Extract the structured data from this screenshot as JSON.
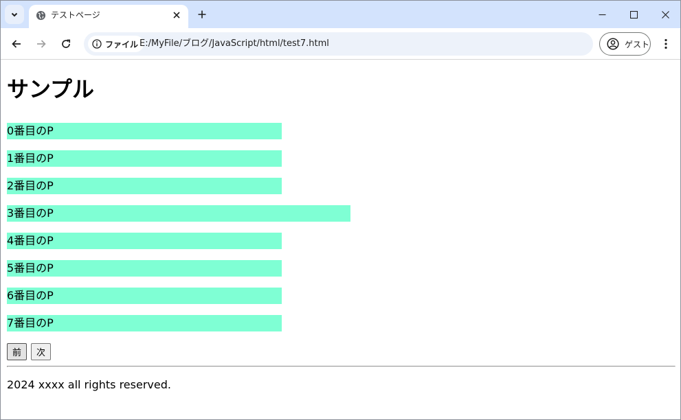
{
  "browser": {
    "tab_title": "テストページ",
    "omnibox_chip": "ファイル",
    "url": "E:/MyFile/ブログ/JavaScript/html/test7.html",
    "profile_label": "ゲスト",
    "colors": {
      "tabstrip": "#d3e3fd",
      "omnibox": "#edf2fa"
    }
  },
  "page": {
    "heading": "サンプル",
    "paragraphs": [
      {
        "text": "0番目のP",
        "wide": false
      },
      {
        "text": "1番目のP",
        "wide": false
      },
      {
        "text": "2番目のP",
        "wide": false
      },
      {
        "text": "3番目のP",
        "wide": true
      },
      {
        "text": "4番目のP",
        "wide": false
      },
      {
        "text": "5番目のP",
        "wide": false
      },
      {
        "text": "6番目のP",
        "wide": false
      },
      {
        "text": "7番目のP",
        "wide": false
      }
    ],
    "paragraph_color": "#7fffd4",
    "prev_button": "前",
    "next_button": "次",
    "footer": "2024 xxxx all rights reserved."
  }
}
